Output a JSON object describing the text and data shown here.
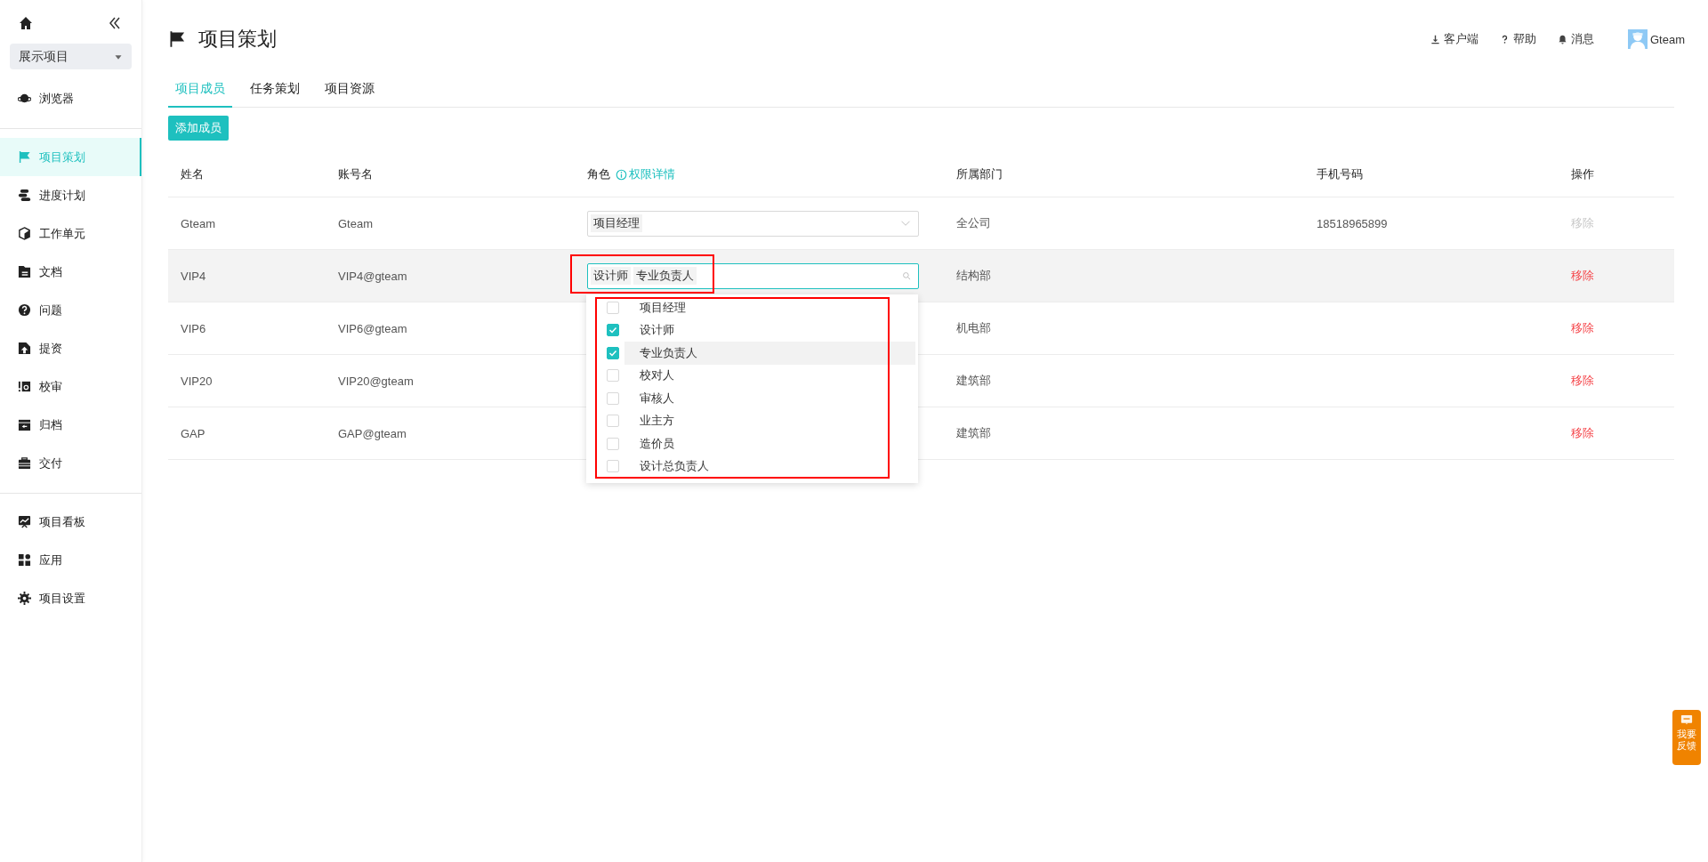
{
  "sidebar": {
    "project_selector": "展示项目",
    "top_items": [
      {
        "label": "浏览器",
        "selected": false
      }
    ],
    "items": [
      {
        "label": "项目策划",
        "selected": true
      },
      {
        "label": "进度计划",
        "selected": false
      },
      {
        "label": "工作单元",
        "selected": false
      },
      {
        "label": "文档",
        "selected": false
      },
      {
        "label": "问题",
        "selected": false
      },
      {
        "label": "提资",
        "selected": false
      },
      {
        "label": "校审",
        "selected": false
      },
      {
        "label": "归档",
        "selected": false
      },
      {
        "label": "交付",
        "selected": false
      }
    ],
    "bottom_items": [
      {
        "label": "项目看板",
        "selected": false
      },
      {
        "label": "应用",
        "selected": false
      },
      {
        "label": "项目设置",
        "selected": false
      }
    ]
  },
  "header": {
    "title": "项目策划",
    "links": [
      "客户端",
      "帮助",
      "消息"
    ],
    "user": "Gteam"
  },
  "tabs": [
    {
      "label": "项目成员",
      "selected": true
    },
    {
      "label": "任务策划",
      "selected": false
    },
    {
      "label": "项目资源",
      "selected": false
    }
  ],
  "add_button": "添加成员",
  "table": {
    "columns": [
      "姓名",
      "账号名",
      "角色",
      "所属部门",
      "手机号码",
      "操作"
    ],
    "role_info_link": "权限详情",
    "rows": [
      {
        "name": "Gteam",
        "account": "Gteam",
        "roles": [
          "项目经理"
        ],
        "focused": false,
        "hovered": false,
        "department": "全公司",
        "phone": "18518965899",
        "action": "移除",
        "disabled": true
      },
      {
        "name": "VIP4",
        "account": "VIP4@gteam",
        "roles": [
          "设计师",
          "专业负责人"
        ],
        "focused": true,
        "hovered": true,
        "department": "结构部",
        "action": "移除",
        "disabled": false
      },
      {
        "name": "VIP6",
        "account": "VIP6@gteam",
        "focused": false,
        "hovered": false,
        "department": "机电部",
        "action": "移除",
        "disabled": false
      },
      {
        "name": "VIP20",
        "account": "VIP20@gteam",
        "focused": false,
        "hovered": false,
        "department": "建筑部",
        "action": "移除",
        "disabled": false
      },
      {
        "name": "GAP",
        "account": "GAP@gteam",
        "focused": false,
        "hovered": false,
        "department": "建筑部",
        "action": "移除",
        "disabled": false
      }
    ]
  },
  "role_dropdown": {
    "framed": true,
    "options": [
      {
        "label": "项目经理",
        "checked": false,
        "hovered": false
      },
      {
        "label": "设计师",
        "checked": true,
        "hovered": false
      },
      {
        "label": "专业负责人",
        "checked": true,
        "hovered": true
      },
      {
        "label": "校对人",
        "checked": false,
        "hovered": false
      },
      {
        "label": "审核人",
        "checked": false,
        "hovered": false
      },
      {
        "label": "业主方",
        "checked": false,
        "hovered": false
      },
      {
        "label": "造价员",
        "checked": false,
        "hovered": false
      },
      {
        "label": "设计总负责人",
        "checked": false,
        "hovered": false
      }
    ]
  },
  "feedback_button": "我要反馈"
}
